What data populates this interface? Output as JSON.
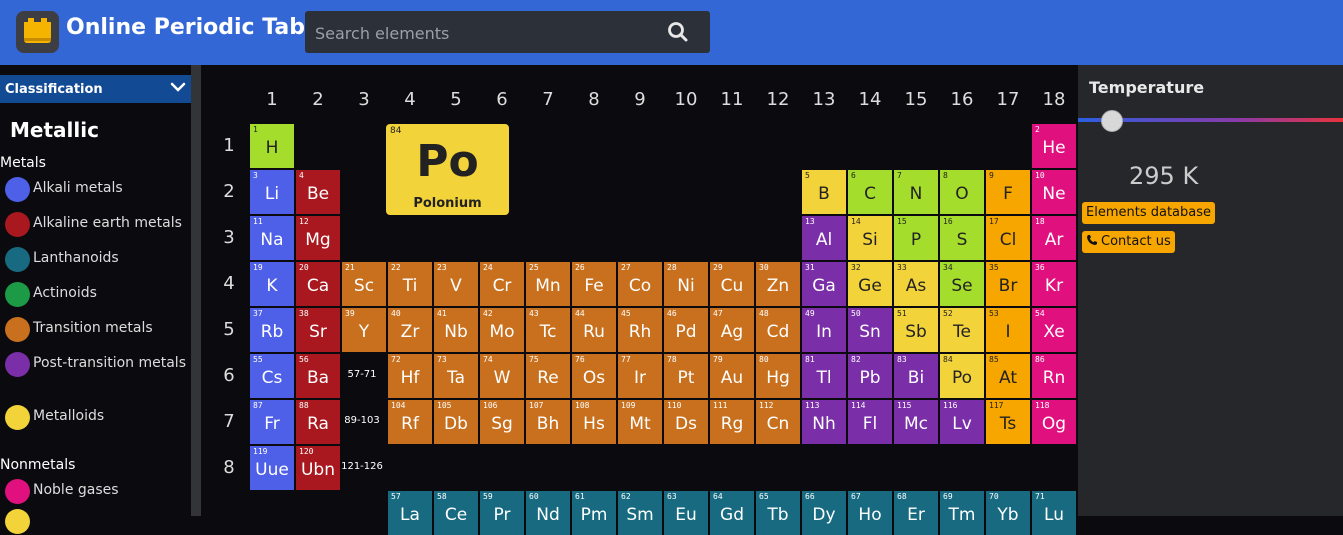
{
  "header": {
    "title": "Online Periodic Table",
    "search_placeholder": "Search elements"
  },
  "sidebar": {
    "classification_label": "Classification",
    "category_title": "Metallic",
    "group_metals": "Metals",
    "group_nonmetals": "Nonmetals",
    "legend": [
      {
        "label": "Alkali metals",
        "color": "#4e5fe8"
      },
      {
        "label": "Alkaline earth metals",
        "color": "#a8181e"
      },
      {
        "label": "Lanthanoids",
        "color": "#176a80"
      },
      {
        "label": "Actinoids",
        "color": "#1c9a45"
      },
      {
        "label": "Transition metals",
        "color": "#c8701e"
      },
      {
        "label": "Post-transition metals",
        "color": "#7a2ea8"
      },
      {
        "label": "Metalloids",
        "color": "#f3d33a"
      },
      {
        "label": "Noble gases",
        "color": "#e0107e"
      }
    ]
  },
  "table": {
    "columns": [
      "1",
      "2",
      "3",
      "4",
      "5",
      "6",
      "7",
      "8",
      "9",
      "10",
      "11",
      "12",
      "13",
      "14",
      "15",
      "16",
      "17",
      "18"
    ],
    "rows": [
      "1",
      "2",
      "3",
      "4",
      "5",
      "6",
      "7",
      "8"
    ],
    "ranges": [
      "57-71",
      "89-103",
      "121-126"
    ],
    "featured": {
      "number": "84",
      "symbol": "Po",
      "name": "Polonium"
    },
    "colors": {
      "alkali": "#4e5fe8",
      "alkaline": "#a8181e",
      "transition": "#c8701e",
      "post": "#7a2ea8",
      "metalloid": "#f3d33a",
      "nonmetal": "#a5dd2c",
      "halogen": "#f7a600",
      "noble": "#e0107e",
      "lanthanoid": "#176a80"
    },
    "elements": [
      {
        "n": "1",
        "s": "H",
        "r": 1,
        "c": 1,
        "t": "nonmetal"
      },
      {
        "n": "2",
        "s": "He",
        "r": 1,
        "c": 18,
        "t": "noble"
      },
      {
        "n": "3",
        "s": "Li",
        "r": 2,
        "c": 1,
        "t": "alkali"
      },
      {
        "n": "4",
        "s": "Be",
        "r": 2,
        "c": 2,
        "t": "alkaline"
      },
      {
        "n": "5",
        "s": "B",
        "r": 2,
        "c": 13,
        "t": "metalloid"
      },
      {
        "n": "6",
        "s": "C",
        "r": 2,
        "c": 14,
        "t": "nonmetal"
      },
      {
        "n": "7",
        "s": "N",
        "r": 2,
        "c": 15,
        "t": "nonmetal"
      },
      {
        "n": "8",
        "s": "O",
        "r": 2,
        "c": 16,
        "t": "nonmetal"
      },
      {
        "n": "9",
        "s": "F",
        "r": 2,
        "c": 17,
        "t": "halogen"
      },
      {
        "n": "10",
        "s": "Ne",
        "r": 2,
        "c": 18,
        "t": "noble"
      },
      {
        "n": "11",
        "s": "Na",
        "r": 3,
        "c": 1,
        "t": "alkali"
      },
      {
        "n": "12",
        "s": "Mg",
        "r": 3,
        "c": 2,
        "t": "alkaline"
      },
      {
        "n": "13",
        "s": "Al",
        "r": 3,
        "c": 13,
        "t": "post"
      },
      {
        "n": "14",
        "s": "Si",
        "r": 3,
        "c": 14,
        "t": "metalloid"
      },
      {
        "n": "15",
        "s": "P",
        "r": 3,
        "c": 15,
        "t": "nonmetal"
      },
      {
        "n": "16",
        "s": "S",
        "r": 3,
        "c": 16,
        "t": "nonmetal"
      },
      {
        "n": "17",
        "s": "Cl",
        "r": 3,
        "c": 17,
        "t": "halogen"
      },
      {
        "n": "18",
        "s": "Ar",
        "r": 3,
        "c": 18,
        "t": "noble"
      },
      {
        "n": "19",
        "s": "K",
        "r": 4,
        "c": 1,
        "t": "alkali"
      },
      {
        "n": "20",
        "s": "Ca",
        "r": 4,
        "c": 2,
        "t": "alkaline"
      },
      {
        "n": "21",
        "s": "Sc",
        "r": 4,
        "c": 3,
        "t": "transition"
      },
      {
        "n": "22",
        "s": "Ti",
        "r": 4,
        "c": 4,
        "t": "transition"
      },
      {
        "n": "23",
        "s": "V",
        "r": 4,
        "c": 5,
        "t": "transition"
      },
      {
        "n": "24",
        "s": "Cr",
        "r": 4,
        "c": 6,
        "t": "transition"
      },
      {
        "n": "25",
        "s": "Mn",
        "r": 4,
        "c": 7,
        "t": "transition"
      },
      {
        "n": "26",
        "s": "Fe",
        "r": 4,
        "c": 8,
        "t": "transition"
      },
      {
        "n": "27",
        "s": "Co",
        "r": 4,
        "c": 9,
        "t": "transition"
      },
      {
        "n": "28",
        "s": "Ni",
        "r": 4,
        "c": 10,
        "t": "transition"
      },
      {
        "n": "29",
        "s": "Cu",
        "r": 4,
        "c": 11,
        "t": "transition"
      },
      {
        "n": "30",
        "s": "Zn",
        "r": 4,
        "c": 12,
        "t": "transition"
      },
      {
        "n": "31",
        "s": "Ga",
        "r": 4,
        "c": 13,
        "t": "post"
      },
      {
        "n": "32",
        "s": "Ge",
        "r": 4,
        "c": 14,
        "t": "metalloid"
      },
      {
        "n": "33",
        "s": "As",
        "r": 4,
        "c": 15,
        "t": "metalloid"
      },
      {
        "n": "34",
        "s": "Se",
        "r": 4,
        "c": 16,
        "t": "nonmetal"
      },
      {
        "n": "35",
        "s": "Br",
        "r": 4,
        "c": 17,
        "t": "halogen"
      },
      {
        "n": "36",
        "s": "Kr",
        "r": 4,
        "c": 18,
        "t": "noble"
      },
      {
        "n": "37",
        "s": "Rb",
        "r": 5,
        "c": 1,
        "t": "alkali"
      },
      {
        "n": "38",
        "s": "Sr",
        "r": 5,
        "c": 2,
        "t": "alkaline"
      },
      {
        "n": "39",
        "s": "Y",
        "r": 5,
        "c": 3,
        "t": "transition"
      },
      {
        "n": "40",
        "s": "Zr",
        "r": 5,
        "c": 4,
        "t": "transition"
      },
      {
        "n": "41",
        "s": "Nb",
        "r": 5,
        "c": 5,
        "t": "transition"
      },
      {
        "n": "42",
        "s": "Mo",
        "r": 5,
        "c": 6,
        "t": "transition"
      },
      {
        "n": "43",
        "s": "Tc",
        "r": 5,
        "c": 7,
        "t": "transition"
      },
      {
        "n": "44",
        "s": "Ru",
        "r": 5,
        "c": 8,
        "t": "transition"
      },
      {
        "n": "45",
        "s": "Rh",
        "r": 5,
        "c": 9,
        "t": "transition"
      },
      {
        "n": "46",
        "s": "Pd",
        "r": 5,
        "c": 10,
        "t": "transition"
      },
      {
        "n": "47",
        "s": "Ag",
        "r": 5,
        "c": 11,
        "t": "transition"
      },
      {
        "n": "48",
        "s": "Cd",
        "r": 5,
        "c": 12,
        "t": "transition"
      },
      {
        "n": "49",
        "s": "In",
        "r": 5,
        "c": 13,
        "t": "post"
      },
      {
        "n": "50",
        "s": "Sn",
        "r": 5,
        "c": 14,
        "t": "post"
      },
      {
        "n": "51",
        "s": "Sb",
        "r": 5,
        "c": 15,
        "t": "metalloid"
      },
      {
        "n": "52",
        "s": "Te",
        "r": 5,
        "c": 16,
        "t": "metalloid"
      },
      {
        "n": "53",
        "s": "I",
        "r": 5,
        "c": 17,
        "t": "halogen"
      },
      {
        "n": "54",
        "s": "Xe",
        "r": 5,
        "c": 18,
        "t": "noble"
      },
      {
        "n": "55",
        "s": "Cs",
        "r": 6,
        "c": 1,
        "t": "alkali"
      },
      {
        "n": "56",
        "s": "Ba",
        "r": 6,
        "c": 2,
        "t": "alkaline"
      },
      {
        "n": "72",
        "s": "Hf",
        "r": 6,
        "c": 4,
        "t": "transition"
      },
      {
        "n": "73",
        "s": "Ta",
        "r": 6,
        "c": 5,
        "t": "transition"
      },
      {
        "n": "74",
        "s": "W",
        "r": 6,
        "c": 6,
        "t": "transition"
      },
      {
        "n": "75",
        "s": "Re",
        "r": 6,
        "c": 7,
        "t": "transition"
      },
      {
        "n": "76",
        "s": "Os",
        "r": 6,
        "c": 8,
        "t": "transition"
      },
      {
        "n": "77",
        "s": "Ir",
        "r": 6,
        "c": 9,
        "t": "transition"
      },
      {
        "n": "78",
        "s": "Pt",
        "r": 6,
        "c": 10,
        "t": "transition"
      },
      {
        "n": "79",
        "s": "Au",
        "r": 6,
        "c": 11,
        "t": "transition"
      },
      {
        "n": "80",
        "s": "Hg",
        "r": 6,
        "c": 12,
        "t": "transition"
      },
      {
        "n": "81",
        "s": "Tl",
        "r": 6,
        "c": 13,
        "t": "post"
      },
      {
        "n": "82",
        "s": "Pb",
        "r": 6,
        "c": 14,
        "t": "post"
      },
      {
        "n": "83",
        "s": "Bi",
        "r": 6,
        "c": 15,
        "t": "post"
      },
      {
        "n": "84",
        "s": "Po",
        "r": 6,
        "c": 16,
        "t": "metalloid"
      },
      {
        "n": "85",
        "s": "At",
        "r": 6,
        "c": 17,
        "t": "halogen"
      },
      {
        "n": "86",
        "s": "Rn",
        "r": 6,
        "c": 18,
        "t": "noble"
      },
      {
        "n": "87",
        "s": "Fr",
        "r": 7,
        "c": 1,
        "t": "alkali"
      },
      {
        "n": "88",
        "s": "Ra",
        "r": 7,
        "c": 2,
        "t": "alkaline"
      },
      {
        "n": "104",
        "s": "Rf",
        "r": 7,
        "c": 4,
        "t": "transition"
      },
      {
        "n": "105",
        "s": "Db",
        "r": 7,
        "c": 5,
        "t": "transition"
      },
      {
        "n": "106",
        "s": "Sg",
        "r": 7,
        "c": 6,
        "t": "transition"
      },
      {
        "n": "107",
        "s": "Bh",
        "r": 7,
        "c": 7,
        "t": "transition"
      },
      {
        "n": "108",
        "s": "Hs",
        "r": 7,
        "c": 8,
        "t": "transition"
      },
      {
        "n": "109",
        "s": "Mt",
        "r": 7,
        "c": 9,
        "t": "transition"
      },
      {
        "n": "110",
        "s": "Ds",
        "r": 7,
        "c": 10,
        "t": "transition"
      },
      {
        "n": "111",
        "s": "Rg",
        "r": 7,
        "c": 11,
        "t": "transition"
      },
      {
        "n": "112",
        "s": "Cn",
        "r": 7,
        "c": 12,
        "t": "transition"
      },
      {
        "n": "113",
        "s": "Nh",
        "r": 7,
        "c": 13,
        "t": "post"
      },
      {
        "n": "114",
        "s": "Fl",
        "r": 7,
        "c": 14,
        "t": "post"
      },
      {
        "n": "115",
        "s": "Mc",
        "r": 7,
        "c": 15,
        "t": "post"
      },
      {
        "n": "116",
        "s": "Lv",
        "r": 7,
        "c": 16,
        "t": "post"
      },
      {
        "n": "117",
        "s": "Ts",
        "r": 7,
        "c": 17,
        "t": "halogen"
      },
      {
        "n": "118",
        "s": "Og",
        "r": 7,
        "c": 18,
        "t": "noble"
      },
      {
        "n": "119",
        "s": "Uue",
        "r": 8,
        "c": 1,
        "t": "alkali"
      },
      {
        "n": "120",
        "s": "Ubn",
        "r": 8,
        "c": 2,
        "t": "alkaline"
      },
      {
        "n": "57",
        "s": "La",
        "r": 9,
        "c": 4,
        "t": "lanthanoid"
      },
      {
        "n": "58",
        "s": "Ce",
        "r": 9,
        "c": 5,
        "t": "lanthanoid"
      },
      {
        "n": "59",
        "s": "Pr",
        "r": 9,
        "c": 6,
        "t": "lanthanoid"
      },
      {
        "n": "60",
        "s": "Nd",
        "r": 9,
        "c": 7,
        "t": "lanthanoid"
      },
      {
        "n": "61",
        "s": "Pm",
        "r": 9,
        "c": 8,
        "t": "lanthanoid"
      },
      {
        "n": "62",
        "s": "Sm",
        "r": 9,
        "c": 9,
        "t": "lanthanoid"
      },
      {
        "n": "63",
        "s": "Eu",
        "r": 9,
        "c": 10,
        "t": "lanthanoid"
      },
      {
        "n": "64",
        "s": "Gd",
        "r": 9,
        "c": 11,
        "t": "lanthanoid"
      },
      {
        "n": "65",
        "s": "Tb",
        "r": 9,
        "c": 12,
        "t": "lanthanoid"
      },
      {
        "n": "66",
        "s": "Dy",
        "r": 9,
        "c": 13,
        "t": "lanthanoid"
      },
      {
        "n": "67",
        "s": "Ho",
        "r": 9,
        "c": 14,
        "t": "lanthanoid"
      },
      {
        "n": "68",
        "s": "Er",
        "r": 9,
        "c": 15,
        "t": "lanthanoid"
      },
      {
        "n": "69",
        "s": "Tm",
        "r": 9,
        "c": 16,
        "t": "lanthanoid"
      },
      {
        "n": "70",
        "s": "Yb",
        "r": 9,
        "c": 17,
        "t": "lanthanoid"
      },
      {
        "n": "71",
        "s": "Lu",
        "r": 9,
        "c": 18,
        "t": "lanthanoid"
      }
    ]
  },
  "temperature": {
    "label": "Temperature",
    "value_text": "295 K",
    "slider_fraction": 0.08
  },
  "links": {
    "database": "Elements database",
    "contact": "Contact us"
  }
}
